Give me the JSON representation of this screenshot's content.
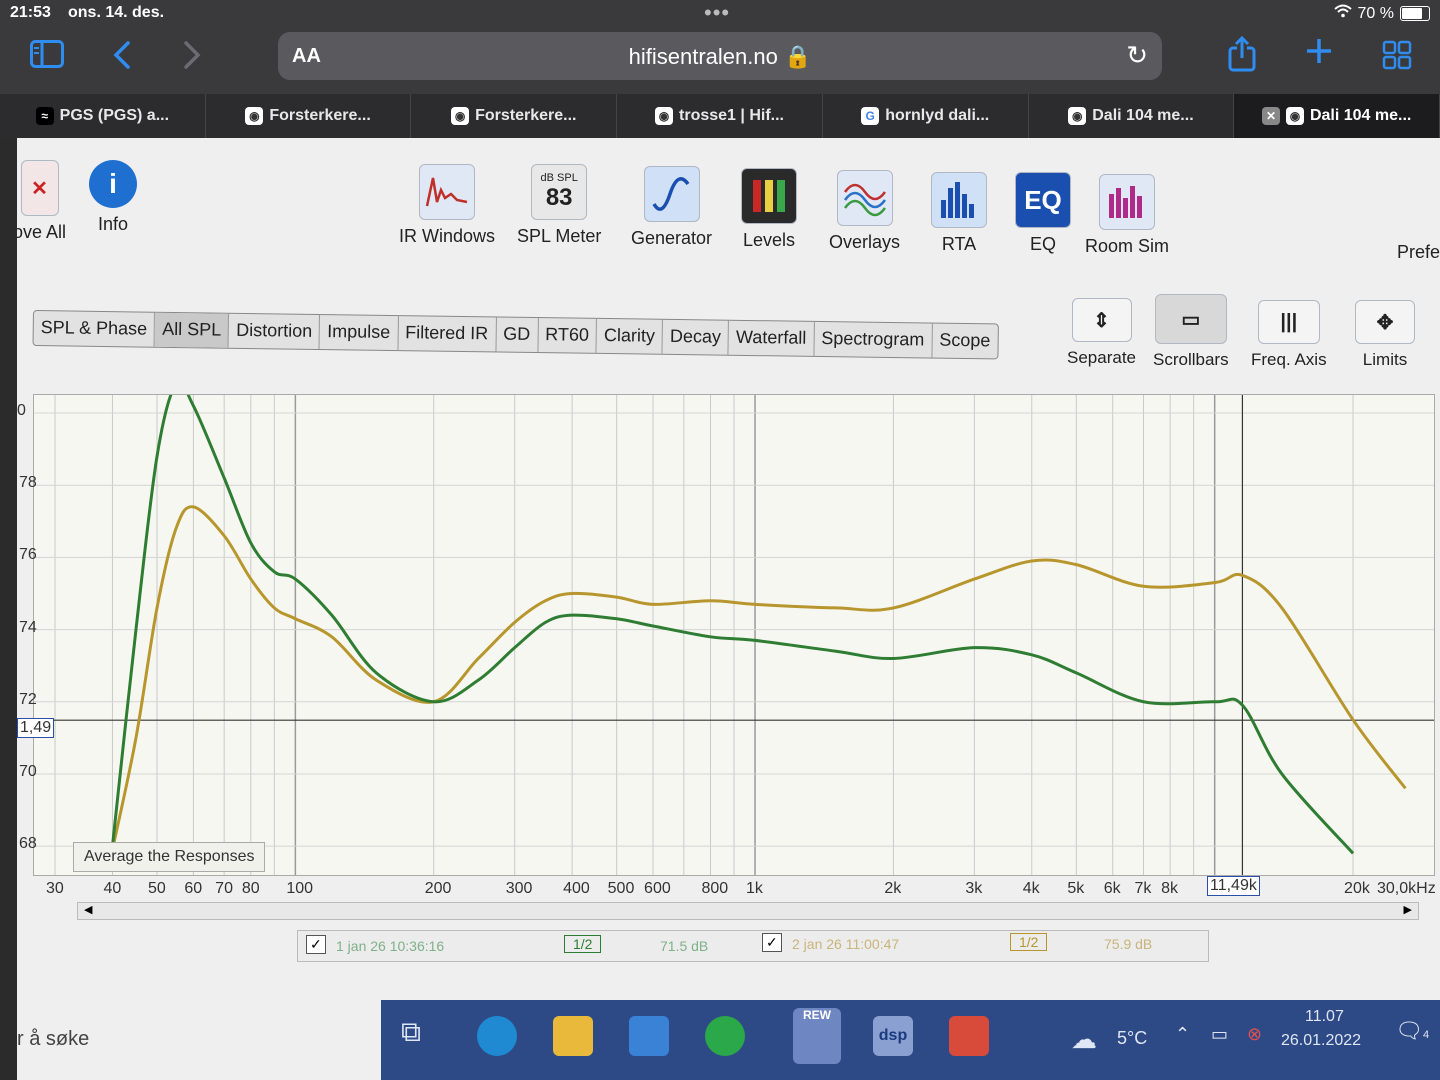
{
  "status": {
    "time": "21:53",
    "date": "ons. 14. des.",
    "battery": "70 %",
    "battery_level": 0.7
  },
  "browser": {
    "aa": "AA",
    "url": "hifisentralen.no",
    "tabs": [
      {
        "label": "PGS (PGS) a..."
      },
      {
        "label": "Forsterkere..."
      },
      {
        "label": "Forsterkere..."
      },
      {
        "label": "trosse1 | Hif..."
      },
      {
        "label": "hornlyd dali..."
      },
      {
        "label": "Dali 104 me..."
      },
      {
        "label": "Dali 104 me..."
      }
    ]
  },
  "rew": {
    "left_tools": [
      {
        "label": "ove All"
      },
      {
        "label": "Info"
      }
    ],
    "tools": [
      {
        "label": "IR Windows",
        "icon": "ir-windows-icon"
      },
      {
        "label": "SPL Meter",
        "icon": "spl-meter-icon",
        "top": "dB SPL",
        "value": "83"
      },
      {
        "label": "Generator",
        "icon": "generator-icon"
      },
      {
        "label": "Levels",
        "icon": "levels-icon"
      },
      {
        "label": "Overlays",
        "icon": "overlays-icon"
      },
      {
        "label": "RTA",
        "icon": "rta-icon"
      },
      {
        "label": "EQ",
        "icon": "eq-icon",
        "text": "EQ"
      },
      {
        "label": "Room Sim",
        "icon": "room-sim-icon"
      }
    ],
    "pref": "Prefe",
    "subtabs": [
      "SPL & Phase",
      "All SPL",
      "Distortion",
      "Impulse",
      "Filtered IR",
      "GD",
      "RT60",
      "Clarity",
      "Decay",
      "Waterfall",
      "Spectrogram",
      "Scope"
    ],
    "active_subtab": "All SPL",
    "graph_tools": [
      {
        "label": "Separate"
      },
      {
        "label": "Scrollbars"
      },
      {
        "label": "Freq. Axis"
      },
      {
        "label": "Limits"
      }
    ],
    "avg_button": "Average the Responses",
    "cursor_y": "1,49",
    "cursor_x": "11,49k",
    "legend": [
      {
        "check": "✓",
        "name": "1 jan 26 10:36:16",
        "smoothing": "1/2",
        "level": "71.5 dB"
      },
      {
        "check": "✓",
        "name": "2 jan 26 11:00:47",
        "smoothing": "1/2",
        "level": "75.9 dB"
      }
    ]
  },
  "chart_data": {
    "type": "line",
    "xlabel": "",
    "ylabel": "",
    "xscale": "log",
    "xlim": [
      27,
      30000
    ],
    "ylim": [
      67.2,
      80.5
    ],
    "y_ticks": [
      "0",
      "78",
      "76",
      "74",
      "72",
      "70",
      "68"
    ],
    "x_ticks": [
      "30",
      "40",
      "50",
      "60",
      "70",
      "80",
      "100",
      "200",
      "300",
      "400",
      "500",
      "600",
      "800",
      "1k",
      "2k",
      "3k",
      "4k",
      "5k",
      "6k",
      "7k",
      "8k",
      "1",
      "20k",
      "30,0kHz"
    ],
    "series": [
      {
        "color": "#2e7d32",
        "x": [
          40,
          45,
          50,
          55,
          60,
          70,
          80,
          90,
          100,
          120,
          150,
          200,
          250,
          300,
          350,
          400,
          500,
          600,
          800,
          1000,
          1500,
          2000,
          3000,
          4000,
          5000,
          7000,
          10000,
          11500,
          14000,
          20000
        ],
        "y": [
          68.0,
          74.0,
          78.8,
          80.8,
          80.2,
          78.2,
          76.4,
          75.6,
          75.4,
          74.4,
          72.8,
          72.0,
          72.6,
          73.5,
          74.2,
          74.4,
          74.3,
          74.1,
          73.8,
          73.7,
          73.4,
          73.2,
          73.5,
          73.3,
          72.8,
          72.0,
          72.0,
          71.9,
          70.0,
          67.8
        ]
      },
      {
        "color": "#b8962e",
        "x": [
          40,
          45,
          50,
          55,
          60,
          70,
          80,
          90,
          100,
          120,
          150,
          200,
          250,
          300,
          350,
          400,
          500,
          600,
          800,
          1000,
          1500,
          2000,
          3000,
          4000,
          5000,
          7000,
          10000,
          11500,
          14000,
          20000,
          26000
        ],
        "y": [
          67.9,
          71.0,
          74.6,
          76.8,
          77.4,
          76.6,
          75.4,
          74.6,
          74.3,
          73.8,
          72.6,
          72.0,
          73.2,
          74.2,
          74.8,
          75.0,
          74.9,
          74.7,
          74.8,
          74.7,
          74.6,
          74.6,
          75.4,
          75.9,
          75.8,
          75.2,
          75.3,
          75.5,
          74.6,
          71.5,
          69.6
        ]
      }
    ]
  },
  "windows": {
    "search": "r å søke",
    "temp": "5°C",
    "clock_time": "11.07",
    "clock_date": "26.01.2022",
    "notif": "4",
    "rew_icon": "REW",
    "dsp_icon": "dsp"
  }
}
